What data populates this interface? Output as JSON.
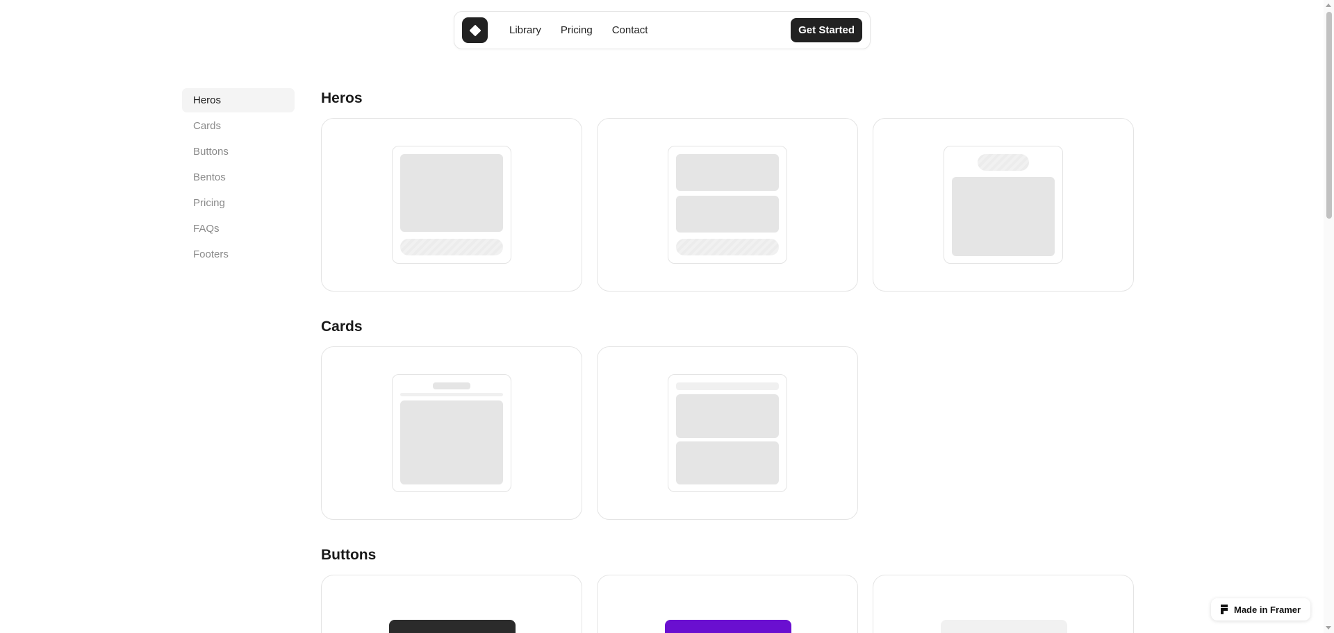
{
  "nav": {
    "logo_icon": "diamond-icon",
    "links": [
      "Library",
      "Pricing",
      "Contact"
    ],
    "cta_label": "Get Started"
  },
  "sidebar": {
    "items": [
      {
        "label": "Heros",
        "active": true
      },
      {
        "label": "Cards",
        "active": false
      },
      {
        "label": "Buttons",
        "active": false
      },
      {
        "label": "Bentos",
        "active": false
      },
      {
        "label": "Pricing",
        "active": false
      },
      {
        "label": "FAQs",
        "active": false
      },
      {
        "label": "Footers",
        "active": false
      }
    ]
  },
  "sections": {
    "heros": {
      "title": "Heros"
    },
    "cards": {
      "title": "Cards"
    },
    "buttons": {
      "title": "Buttons"
    }
  },
  "button_previews": {
    "colors": [
      "#2b2b2b",
      "#6a0fd0",
      "#f1f1f1"
    ]
  },
  "badge": {
    "label": "Made in Framer",
    "icon": "framer-icon"
  },
  "colors": {
    "accent_dark": "#222222",
    "purple": "#6a0fd0"
  }
}
